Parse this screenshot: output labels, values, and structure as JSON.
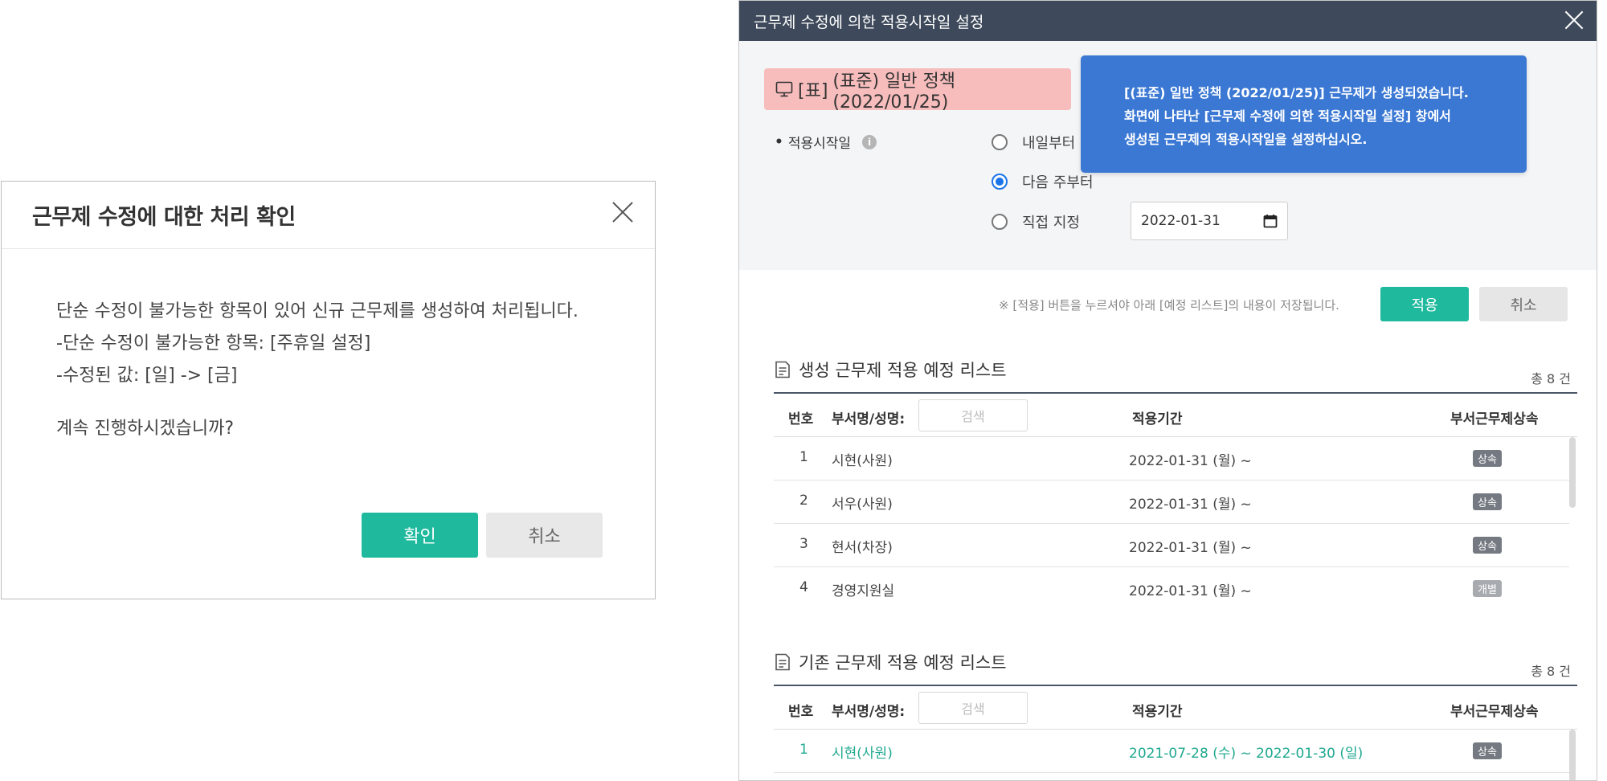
{
  "confirm_dialog": {
    "title": "근무제 수정에 대한 처리 확인",
    "lines": [
      "단순 수정이 불가능한 항목이 있어 신규 근무제를 생성하여 처리됩니다.",
      "-단순 수정이 불가능한 항목: [주휴일 설정]",
      "-수정된 값: [일] -> [금]"
    ],
    "question": "계속 진행하시겠습니까?",
    "confirm_label": "확인",
    "cancel_label": "취소"
  },
  "panel": {
    "title": "근무제 수정에 의한 적용시작일 설정",
    "policy_chip": {
      "prefix": "[표]",
      "text": "(표준) 일반 정책 (2022/01/25)"
    },
    "start_label": "적용시작일",
    "info_icon": "i",
    "options": [
      {
        "label": "내일부터",
        "checked": false
      },
      {
        "label": "다음 주부터",
        "checked": true
      },
      {
        "label": "직접 지정",
        "checked": false
      }
    ],
    "date_value": "2022-01-31",
    "tooltip": [
      "[(표준) 일반 정책 (2022/01/25)] 근무제가 생성되었습니다.",
      "화면에 나타난 [근무제 수정에 의한 적용시작일 설정] 창에서",
      "생성된 근무제의 적용시작일을 설정하십시오."
    ],
    "apply_note": "※ [적용] 버튼을 누르셔야 아래 [예정 리스트]의 내용이 저장됩니다.",
    "apply_label": "적용",
    "cancel_label": "취소",
    "columns": {
      "num": "번호",
      "name": "부서명/성명:",
      "search_placeholder": "검색",
      "period": "적용기간",
      "inherit": "부서근무제상속"
    },
    "new_list": {
      "title": "생성 근무제 적용 예정 리스트",
      "count": "총 8 건",
      "rows": [
        {
          "num": "1",
          "name": "시현(사원)",
          "period": "2022-01-31 (월) ~",
          "badge": "상속"
        },
        {
          "num": "2",
          "name": "서우(사원)",
          "period": "2022-01-31 (월) ~",
          "badge": "상속"
        },
        {
          "num": "3",
          "name": "현서(차장)",
          "period": "2022-01-31 (월) ~",
          "badge": "상속"
        },
        {
          "num": "4",
          "name": "경영지원실",
          "period": "2022-01-31 (월) ~",
          "badge": "개별"
        }
      ]
    },
    "old_list": {
      "title": "기존 근무제 적용 예정 리스트",
      "count": "총 8 건",
      "rows": [
        {
          "num": "1",
          "name": "시현(사원)",
          "period": "2021-07-28 (수) ~ 2022-01-30 (일)",
          "badge": "상속"
        }
      ]
    }
  },
  "colors": {
    "primary": "#1fb99e",
    "header_dark": "#3e4a5b",
    "tooltip_blue": "#3a78d4",
    "chip_pink": "#f7bcbc"
  }
}
